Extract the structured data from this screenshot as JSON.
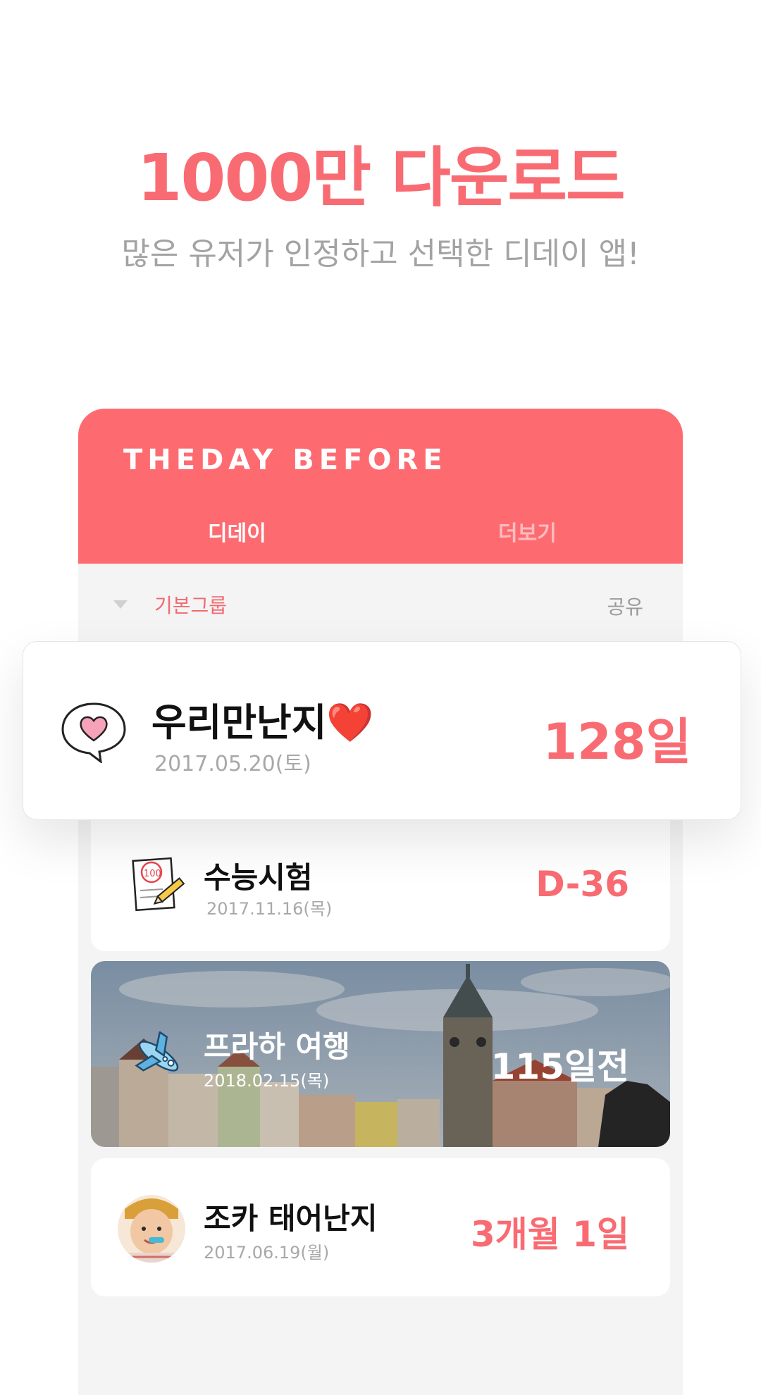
{
  "promo": {
    "headline": "1000만 다운로드",
    "subline": "많은 유저가 인정하고 선택한 디데이 앱!"
  },
  "app": {
    "logo": "THEDAY BEFORE",
    "tabs": [
      "디데이",
      "더보기"
    ],
    "group": {
      "label": "기본그룹",
      "share": "공유"
    }
  },
  "items": [
    {
      "title": "우리만난지❤️",
      "date": "2017.05.20(토)",
      "count": "128일",
      "icon": "heart-bubble-icon"
    },
    {
      "title": "수능시험",
      "date": "2017.11.16(목)",
      "count": "D-36",
      "icon": "exam-paper-icon"
    },
    {
      "title": "프라하 여행",
      "date": "2018.02.15(목)",
      "count": "115일전",
      "icon": "airplane-icon"
    },
    {
      "title": "조카 태어난지",
      "date": "2017.06.19(월)",
      "count": "3개월 1일",
      "icon": "baby-avatar"
    }
  ],
  "colors": {
    "accent": "#f96b72",
    "header_bg": "#fd6b71",
    "group_label": "#f26a71"
  }
}
